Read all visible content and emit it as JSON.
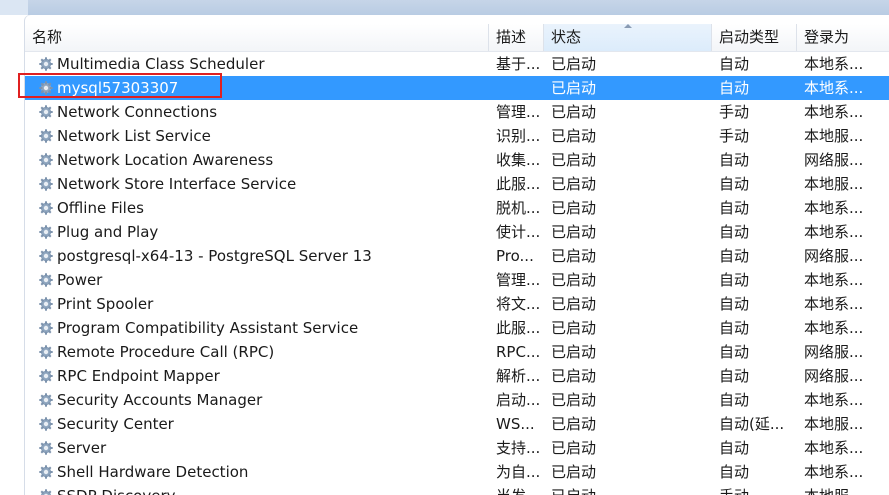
{
  "columns": {
    "name": "名称",
    "description": "描述",
    "status": "状态",
    "startup_type": "启动类型",
    "log_on_as": "登录为"
  },
  "services": [
    {
      "name": "Multimedia Class Scheduler",
      "description": "基于...",
      "status": "已启动",
      "startup_type": "自动",
      "log_on_as": "本地系..."
    },
    {
      "name": "mysql57303307",
      "description": "",
      "status": "已启动",
      "startup_type": "自动",
      "log_on_as": "本地系..."
    },
    {
      "name": "Network Connections",
      "description": "管理...",
      "status": "已启动",
      "startup_type": "手动",
      "log_on_as": "本地系..."
    },
    {
      "name": "Network List Service",
      "description": "识别...",
      "status": "已启动",
      "startup_type": "手动",
      "log_on_as": "本地服..."
    },
    {
      "name": "Network Location Awareness",
      "description": "收集...",
      "status": "已启动",
      "startup_type": "自动",
      "log_on_as": "网络服..."
    },
    {
      "name": "Network Store Interface Service",
      "description": "此服...",
      "status": "已启动",
      "startup_type": "自动",
      "log_on_as": "本地服..."
    },
    {
      "name": "Offline Files",
      "description": "脱机...",
      "status": "已启动",
      "startup_type": "自动",
      "log_on_as": "本地系..."
    },
    {
      "name": "Plug and Play",
      "description": "使计...",
      "status": "已启动",
      "startup_type": "自动",
      "log_on_as": "本地系..."
    },
    {
      "name": "postgresql-x64-13 - PostgreSQL Server 13",
      "description": "Pro...",
      "status": "已启动",
      "startup_type": "自动",
      "log_on_as": "网络服..."
    },
    {
      "name": "Power",
      "description": "管理...",
      "status": "已启动",
      "startup_type": "自动",
      "log_on_as": "本地系..."
    },
    {
      "name": "Print Spooler",
      "description": "将文...",
      "status": "已启动",
      "startup_type": "自动",
      "log_on_as": "本地系..."
    },
    {
      "name": "Program Compatibility Assistant Service",
      "description": "此服...",
      "status": "已启动",
      "startup_type": "自动",
      "log_on_as": "本地系..."
    },
    {
      "name": "Remote Procedure Call (RPC)",
      "description": "RPC...",
      "status": "已启动",
      "startup_type": "自动",
      "log_on_as": "网络服..."
    },
    {
      "name": "RPC Endpoint Mapper",
      "description": "解析...",
      "status": "已启动",
      "startup_type": "自动",
      "log_on_as": "网络服..."
    },
    {
      "name": "Security Accounts Manager",
      "description": "启动...",
      "status": "已启动",
      "startup_type": "自动",
      "log_on_as": "本地系..."
    },
    {
      "name": "Security Center",
      "description": "WS...",
      "status": "已启动",
      "startup_type": "自动(延...",
      "log_on_as": "本地服..."
    },
    {
      "name": "Server",
      "description": "支持...",
      "status": "已启动",
      "startup_type": "自动",
      "log_on_as": "本地系..."
    },
    {
      "name": "Shell Hardware Detection",
      "description": "为自...",
      "status": "已启动",
      "startup_type": "自动",
      "log_on_as": "本地系..."
    },
    {
      "name": "SSDP Discovery",
      "description": "当发...",
      "status": "已启动",
      "startup_type": "手动",
      "log_on_as": "本地服..."
    }
  ],
  "selected_index": 1,
  "colors": {
    "selection": "#3399ff",
    "highlight_box": "#e02020",
    "header_sorted": "#dcecfb"
  },
  "icons": {
    "service": "gear-icon",
    "sort": "sort-ascending-icon"
  }
}
